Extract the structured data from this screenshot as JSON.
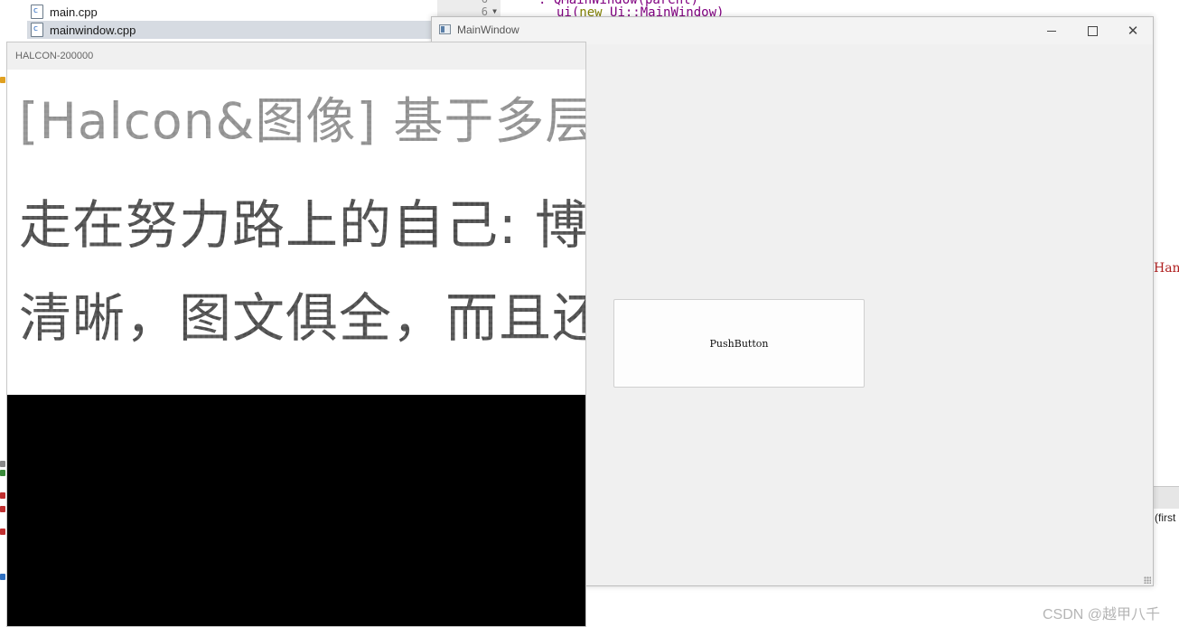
{
  "ide": {
    "tree": [
      {
        "label": "main.cpp",
        "selected": false
      },
      {
        "label": "mainwindow.cpp",
        "selected": true
      }
    ],
    "gutter": {
      "line_a": "6",
      "line_b": "6"
    },
    "code": {
      "line1": ": QMainWindow(parent)",
      "line2_kw": "new",
      "line2_pre": "ui(",
      "line2_post": " Ui::MainWindow)"
    },
    "right_snippet": "Han",
    "right_status_text": "(first"
  },
  "main_window": {
    "title": "MainWindow",
    "minimize_glyph": "",
    "close_glyph": "✕",
    "push_button_label": "PushButton"
  },
  "halcon_window": {
    "title": "HALCON-200000",
    "image_lines": [
      "[Halcon&图像] 基于多层神经",
      "走在努力路上的自己: 博主的",
      "清晰，图文俱全，而且还有"
    ]
  },
  "watermark": "CSDN @越甲八千",
  "colors": {
    "titlebar": "#f3f3f3",
    "window_bg": "#f0f0f0",
    "halcon_bg": "#000000",
    "code_purple": "#800080",
    "code_keyword": "#808000"
  }
}
